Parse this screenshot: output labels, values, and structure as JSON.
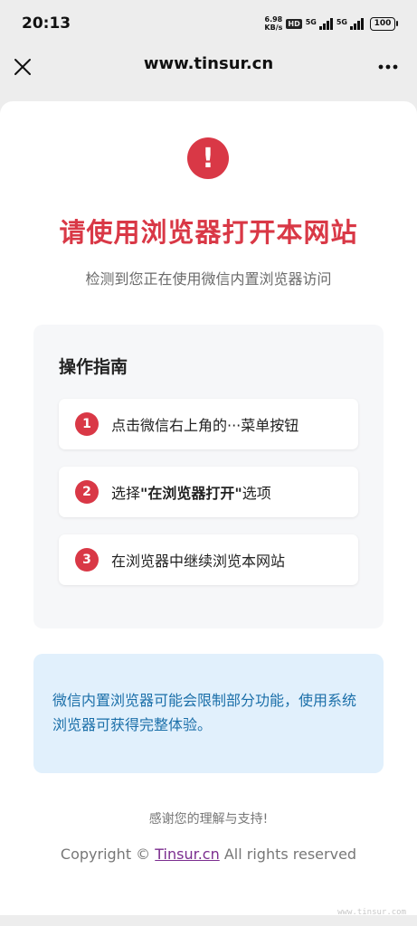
{
  "status_bar": {
    "time": "20:13",
    "speed_value": "6.98",
    "speed_unit": "KB/s",
    "hd_badge": "HD",
    "network_1": "5G",
    "network_2": "5G",
    "battery": "100"
  },
  "nav": {
    "title": "www.tinsur.cn",
    "close_icon": "close-icon",
    "more_icon": "more-dots-icon"
  },
  "page": {
    "alert_icon": "exclamation-icon",
    "alert_symbol": "!",
    "headline": "请使用浏览器打开本网站",
    "subhead": "检测到您正在使用微信内置浏览器访问"
  },
  "guide": {
    "title": "操作指南",
    "steps": [
      {
        "number": "1",
        "text": "点击微信右上角的···菜单按钮"
      },
      {
        "number": "2",
        "prefix": "选择",
        "highlight": "\"在浏览器打开\"",
        "suffix": "选项"
      },
      {
        "number": "3",
        "text": "在浏览器中继续浏览本网站"
      }
    ]
  },
  "tip": {
    "text": "微信内置浏览器可能会限制部分功能，使用系统浏览器可获得完整体验。"
  },
  "footer": {
    "thanks": "感谢您的理解与支持!",
    "copyright_prefix": "Copyright © ",
    "brand_link": "Tinsur.cn",
    "copyright_suffix": " All rights reserved",
    "watermark": "www.tinsur.com"
  },
  "colors": {
    "accent_red": "#d93846",
    "tip_background": "#e1f0fc",
    "tip_text": "#1b6fa9"
  }
}
